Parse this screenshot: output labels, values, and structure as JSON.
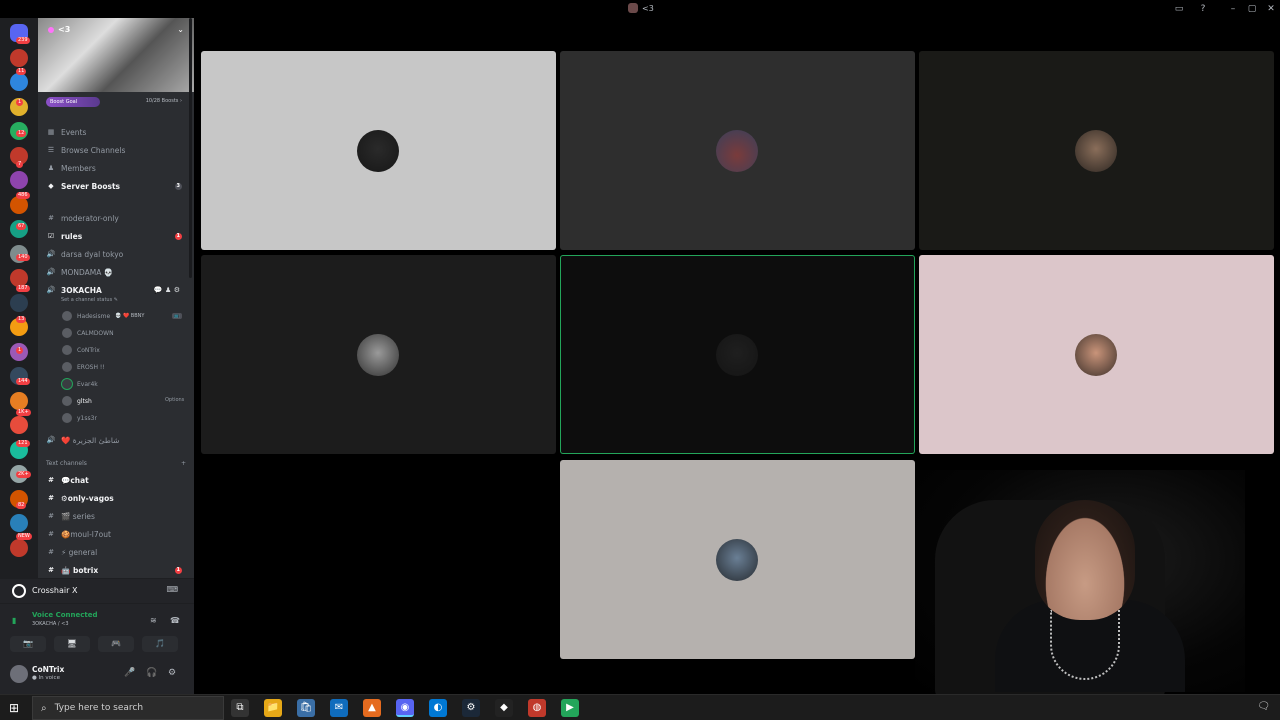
{
  "window": {
    "title": "<3",
    "controls": {
      "inbox": "▭",
      "help": "?",
      "minimize": "–",
      "maximize": "▢",
      "close": "✕"
    }
  },
  "rail_badges": [
    "239",
    "11",
    "1",
    "12",
    "7",
    "486",
    "67",
    "140",
    "187",
    "13",
    "1",
    "144",
    "1K+",
    "121",
    "2K+",
    "82",
    "NEW"
  ],
  "server": {
    "name": "<3",
    "boost_goal": "Boost Goal",
    "boost_count": "10/28 Boosts ›"
  },
  "menu": [
    {
      "icon": "▦",
      "label": "Events"
    },
    {
      "icon": "☰",
      "label": "Browse Channels"
    },
    {
      "icon": "♟",
      "label": "Members"
    },
    {
      "icon": "◆",
      "label": "Server Boosts",
      "badge": "3"
    }
  ],
  "channels_top": [
    {
      "icon": "#",
      "label": "moderator-only"
    },
    {
      "icon": "☑",
      "label": "rules",
      "badge": "1"
    },
    {
      "icon": "🔊",
      "label": "darsa dyal tokyo"
    },
    {
      "icon": "🔊",
      "label": "MONDAMA 💀"
    }
  ],
  "active_vc": {
    "icon": "🔊",
    "label": "3OKACHA",
    "status": "Set a channel status ✎",
    "icons": "💬 ♟ ⚙"
  },
  "vc_users": [
    {
      "name": "Hadesisme",
      "extra": "💀 ❤️ BBNY",
      "tag": "📺"
    },
    {
      "name": "CALMDOWN"
    },
    {
      "name": "CoNTrix"
    },
    {
      "name": "EROSH !!"
    },
    {
      "name": "Evar4k",
      "speaking": true
    },
    {
      "name": "gltsh",
      "hover": true,
      "options": "Options"
    },
    {
      "name": "y1ss3r"
    }
  ],
  "extra_vc": {
    "icon": "🔊",
    "label": "❤️ شاطئ الجزيرة"
  },
  "text_category": {
    "label": "Text channels",
    "add": "+"
  },
  "text_channels": [
    {
      "label": "💬chat",
      "bold": true
    },
    {
      "label": "⚙only-vagos",
      "bold": true
    },
    {
      "label": "🎬 series"
    },
    {
      "label": "🍪moul-l7out"
    },
    {
      "label": "⚡ general"
    },
    {
      "label": "🤖 botrix",
      "bold": true,
      "badge": "1"
    }
  ],
  "activity": {
    "name": "Crosshair X",
    "icon": "⌨"
  },
  "voice": {
    "status": "Voice Connected",
    "channel": "3OKACHA / <3",
    "btn_video": "📷",
    "btn_screen": "🖥",
    "btn_activity": "🎮",
    "btn_soundboard": "🎵",
    "noise_icon": "≋",
    "disconnect_icon": "☎"
  },
  "user": {
    "name": "CoNTrix",
    "status": "● In voice",
    "mic": "🎤",
    "headset": "🎧",
    "settings": "⚙"
  },
  "tiles": [
    {
      "bg": "#c7c7c7",
      "av": "#2a2a2a"
    },
    {
      "bg": "#2e2e2e",
      "av": "#7a3b3b",
      "tint": "#3a3f5a"
    },
    {
      "bg": "#1a1a17",
      "av": "#8a6e5a"
    },
    {
      "bg": "#1c1c1c",
      "av": "#9a9a9a"
    },
    {
      "bg": "#0d0d0d",
      "av": "#1f1f1f",
      "speaking": true
    },
    {
      "bg": "#dcc6ca",
      "av": "#c9947a"
    },
    {
      "bg": "#b5b1ae",
      "av": "#6a7f95"
    }
  ],
  "taskbar": {
    "start": "⊞",
    "search_placeholder": "Type here to search",
    "search_icon": "⌕",
    "apps": [
      "⧉",
      "📁",
      "🛍",
      "✉",
      "▲",
      "◉",
      "◐",
      "⚙",
      "◆",
      "◍",
      "▶"
    ],
    "notif": "🗨"
  }
}
